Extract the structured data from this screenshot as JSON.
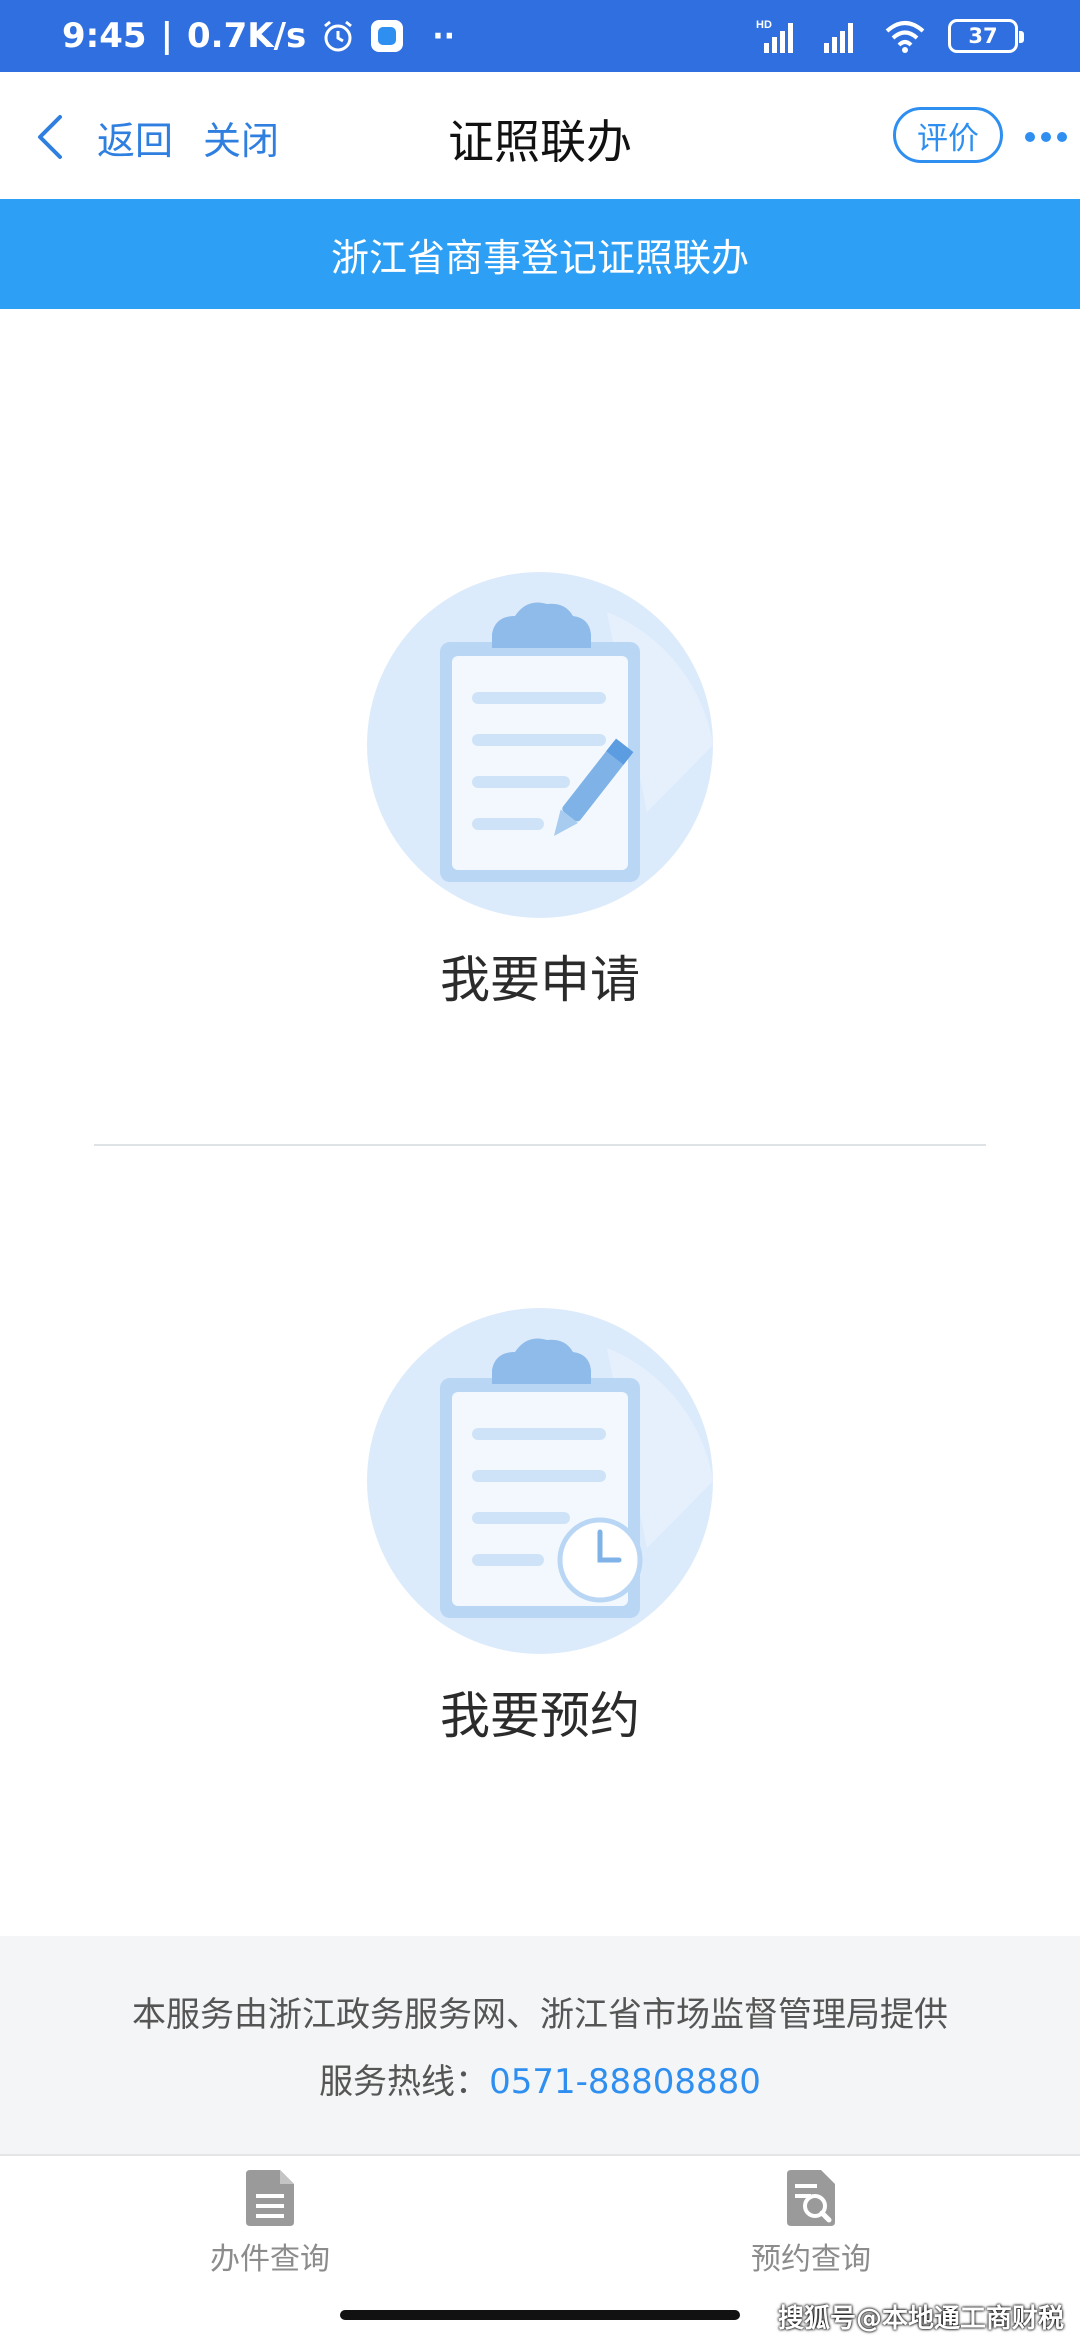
{
  "status_bar": {
    "time": "9:45",
    "separator": "|",
    "net_speed": "0.7K/s",
    "network_label": "HD",
    "battery_level": "37"
  },
  "nav": {
    "back_label": "返回",
    "close_label": "关闭",
    "title": "证照联办",
    "rate_label": "评价"
  },
  "banner": {
    "text": "浙江省商事登记证照联办"
  },
  "options": {
    "apply_label": "我要申请",
    "reserve_label": "我要预约"
  },
  "footer": {
    "provider_text": "本服务由浙江政务服务网、浙江省市场监督管理局提供",
    "hotline_label": "服务热线：",
    "hotline_number": "0571-88808880"
  },
  "tabs": [
    {
      "label": "办件查询",
      "icon": "document-icon"
    },
    {
      "label": "预约查询",
      "icon": "document-search-icon"
    }
  ],
  "watermark": "搜狐号@本地通工商财税",
  "colors": {
    "status_bar": "#2f6fdf",
    "accent": "#2f8ff0",
    "banner": "#2d9ff5",
    "footer_bg": "#f4f5f6"
  }
}
